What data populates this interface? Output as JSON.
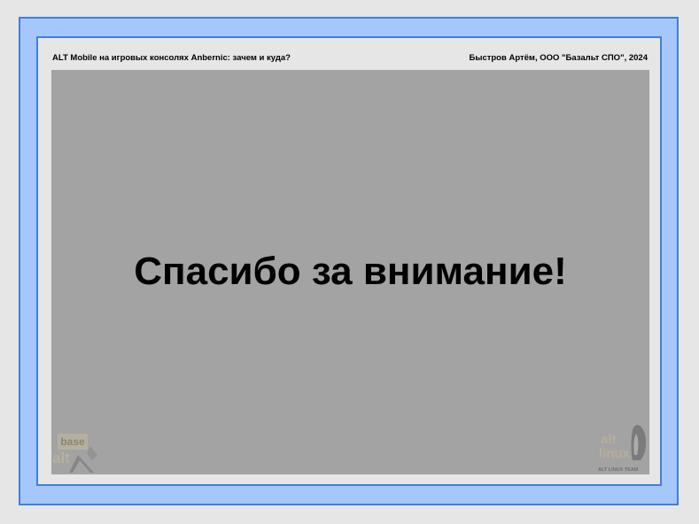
{
  "header": {
    "title": "ALT Mobile на игровых консолях Anbernic: зачем и куда?",
    "author": "Быстров Артём, ООО \"Базальт СПО\", 2024"
  },
  "slide": {
    "main_text": "Спасибо за внимание!"
  },
  "logos": {
    "basealt_line1": "base",
    "basealt_line2": "alt",
    "altlinux_line1": "alt",
    "altlinux_line2": "linux",
    "altlinux_caption": "ALT LINUX TEAM"
  },
  "colors": {
    "page_bg": "#e6e6e6",
    "frame_fill": "#a6c7fb",
    "frame_border": "#3d80dc",
    "content_bg": "#a3a3a3"
  }
}
